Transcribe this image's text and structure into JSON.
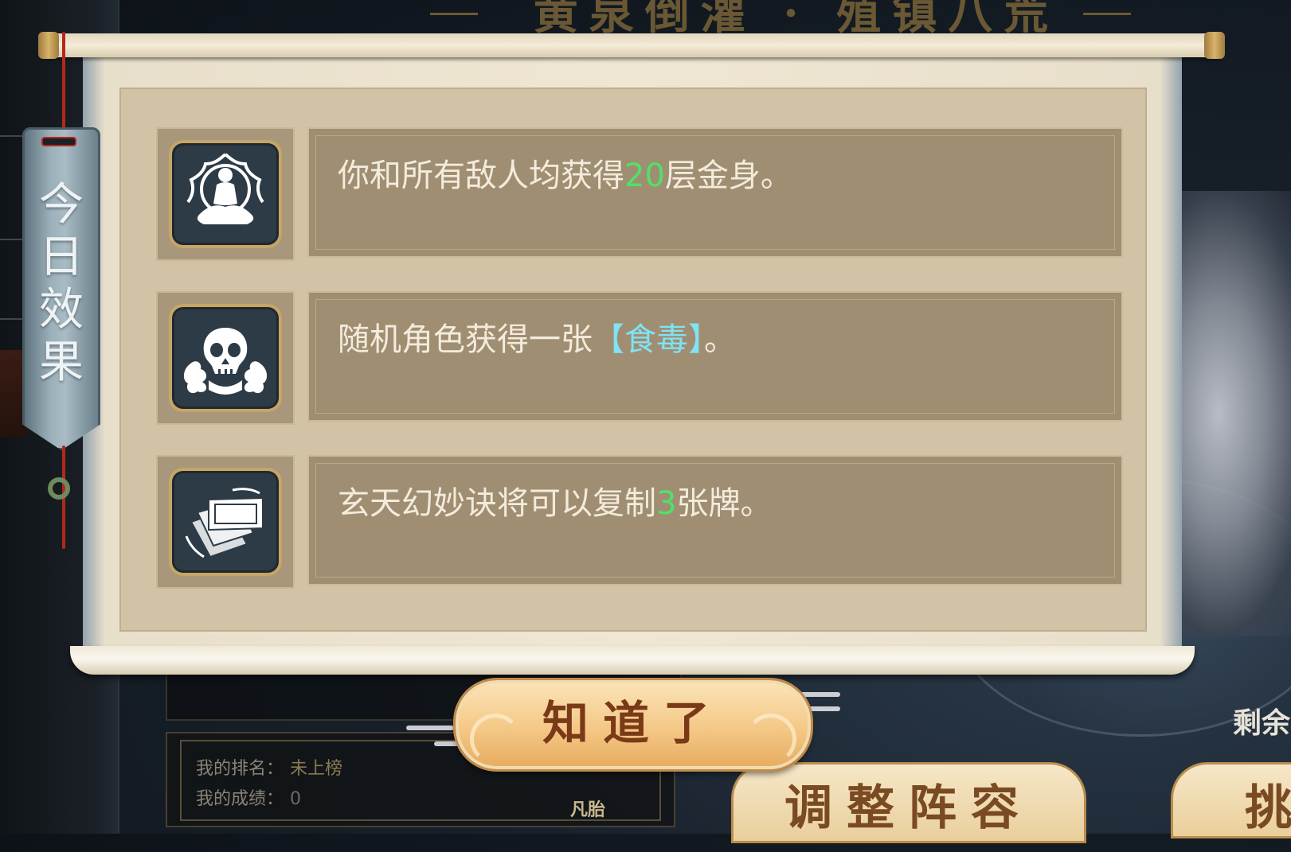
{
  "background": {
    "title": "黄泉倒灌 · 殖镇八荒",
    "remaining_text": "剩余",
    "rank": {
      "rank_label": "我的排名：",
      "rank_value": "未上榜",
      "score_label": "我的成绩：",
      "score_value": "0"
    },
    "fantai_label": "凡胎",
    "adjust_button": "调整阵容",
    "challenge_button": "挑"
  },
  "tag": {
    "label_chars": [
      "今",
      "日",
      "效",
      "果"
    ]
  },
  "effects": [
    {
      "icon": "meditating-buddha-icon",
      "text_before": "你和所有敌人均获得",
      "highlight": "20",
      "highlight_color": "#4ee26a",
      "text_after": "层金身。"
    },
    {
      "icon": "skull-poison-icon",
      "text_before": "随机角色获得一张",
      "highlight": "【食毒】",
      "highlight_color": "#7fe3f2",
      "text_after": "。"
    },
    {
      "icon": "cards-stack-icon",
      "text_before": "玄天幻妙诀将可以复制",
      "highlight": "3",
      "highlight_color": "#4ee26a",
      "text_after": "张牌。"
    }
  ],
  "confirm_button": {
    "label": "知道了"
  },
  "colors": {
    "scroll_paper": "#efe6d3",
    "content_bg": "#d2c3a6",
    "text_frame": "#a08e73",
    "icon_bg": "#2d3b46",
    "icon_border": "#c6a566",
    "button_gold": "#f4c886",
    "button_text": "#7a3a18"
  }
}
